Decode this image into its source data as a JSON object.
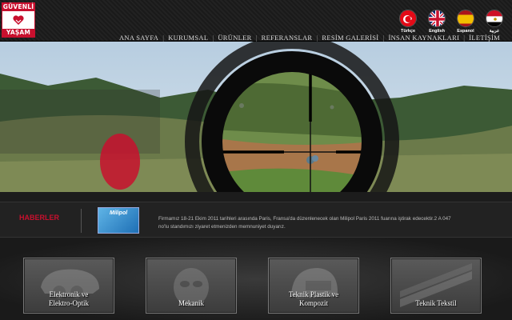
{
  "logo": {
    "top_text": "GÜVENLİ",
    "bottom_text": "YAŞAM"
  },
  "languages": [
    {
      "label": "Türkçe",
      "icon": "turkey-flag-icon"
    },
    {
      "label": "English",
      "icon": "uk-flag-icon"
    },
    {
      "label": "Espanol",
      "icon": "spain-flag-icon"
    },
    {
      "label": "عربية",
      "icon": "egypt-flag-icon"
    }
  ],
  "nav": {
    "items": [
      "ANA SAYFA",
      "KURUMSAL",
      "ÜRÜNLER",
      "REFERANSLAR",
      "RESİM GALERİSİ",
      "İNSAN KAYNAKLARI",
      "İLETİŞİM"
    ]
  },
  "news": {
    "title": "HABERLER",
    "thumb_title": "Milipol",
    "text": "Firmamız 18-21 Ekim 2011 tarihleri arasında Paris, Fransa'da düzenlenecek olan Milipol Paris 2011 fuarına iştirak edecektir.2 A 047 no'lu standımızı ziyaret etmenizden memnuniyet duyarız."
  },
  "categories": [
    {
      "label_line1": "Elektronik ve",
      "label_line2": "Elektro-Optik",
      "icon": "helmet-goggles-icon"
    },
    {
      "label_line1": "Mekanik",
      "label_line2": "",
      "icon": "mask-icon"
    },
    {
      "label_line1": "Teknik Plastik ve",
      "label_line2": "Kompozit",
      "icon": "helmet-icon"
    },
    {
      "label_line1": "Teknik Tekstil",
      "label_line2": "",
      "icon": "fabric-icon"
    }
  ],
  "colors": {
    "brand_red": "#c8102e",
    "background": "#1c1c1c"
  }
}
